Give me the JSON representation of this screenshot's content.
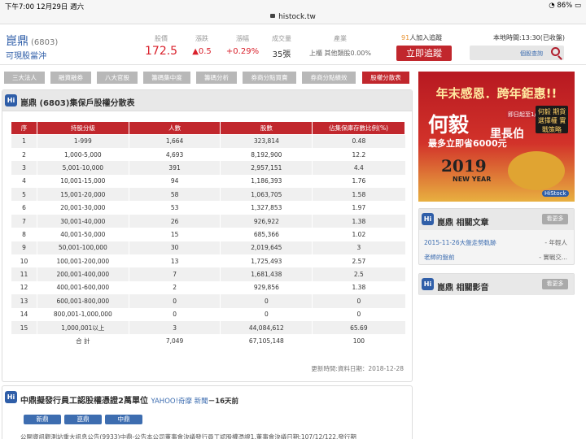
{
  "status_bar": {
    "time": "下午7:00",
    "date": "12月29日 週六",
    "battery": "86%"
  },
  "url": "histock.tw",
  "stock": {
    "name": "崑鼎",
    "code": "(6803)",
    "subtitle": "可現股當沖"
  },
  "stats": [
    {
      "label": "股價",
      "value": "172.5"
    },
    {
      "label": "漲跌",
      "value": "▲0.5"
    },
    {
      "label": "漲幅",
      "value": "+0.29%"
    },
    {
      "label": "成交量",
      "value": "35張"
    },
    {
      "label": "產業",
      "value": "上櫃 其他類股0.00%"
    }
  ],
  "follow": {
    "count": "91",
    "text": "人加入追蹤"
  },
  "track_button": "立即追蹤",
  "local_time": "本地時間:13:30(已收盤)",
  "search_placeholder": "個股查詢",
  "tabs": [
    "三大法人",
    "融資融券",
    "八大官股",
    "籌碼集中度",
    "籌碼分析",
    "券商分點買賣",
    "券商分點績效",
    "股權分散表"
  ],
  "panel_title": "崑鼎 (6803)集保戶股權分散表",
  "table": {
    "headers": [
      "序",
      "持股分級",
      "人數",
      "股數",
      "佔集保庫存數比例(%)"
    ],
    "rows": [
      [
        "1",
        "1-999",
        "1,664",
        "323,814",
        "0.48"
      ],
      [
        "2",
        "1,000-5,000",
        "4,693",
        "8,192,900",
        "12.2"
      ],
      [
        "3",
        "5,001-10,000",
        "391",
        "2,957,151",
        "4.4"
      ],
      [
        "4",
        "10,001-15,000",
        "94",
        "1,186,393",
        "1.76"
      ],
      [
        "5",
        "15,001-20,000",
        "58",
        "1,063,705",
        "1.58"
      ],
      [
        "6",
        "20,001-30,000",
        "53",
        "1,327,853",
        "1.97"
      ],
      [
        "7",
        "30,001-40,000",
        "26",
        "926,922",
        "1.38"
      ],
      [
        "8",
        "40,001-50,000",
        "15",
        "685,366",
        "1.02"
      ],
      [
        "9",
        "50,001-100,000",
        "30",
        "2,019,645",
        "3"
      ],
      [
        "10",
        "100,001-200,000",
        "13",
        "1,725,493",
        "2.57"
      ],
      [
        "11",
        "200,001-400,000",
        "7",
        "1,681,438",
        "2.5"
      ],
      [
        "12",
        "400,001-600,000",
        "2",
        "929,856",
        "1.38"
      ],
      [
        "13",
        "600,001-800,000",
        "0",
        "0",
        "0"
      ],
      [
        "14",
        "800,001-1,000,000",
        "0",
        "0",
        "0"
      ],
      [
        "15",
        "1,000,001以上",
        "3",
        "44,084,612",
        "65.69"
      ],
      [
        "",
        "合 計",
        "7,049",
        "67,105,148",
        "100"
      ]
    ]
  },
  "updated": "更新時間:資料日期：2018-12-28",
  "news": {
    "title": "中鼎擬發行員工認股權憑證2萬單位",
    "source": "YAHOO!奇摩 新聞",
    "age": "－16天前",
    "tags": [
      "新鼎",
      "崑鼎",
      "中鼎"
    ],
    "snippet": "公開資訊觀測站重大訊息公告(9933)中鼎-公告本公司董事會決議發行員工認股權憑證1.董事會決議日期:107/12/122.發行期"
  },
  "ad": {
    "line1": "年末感恩．跨年鉅惠!!",
    "name": "何毅",
    "title_word": "里長伯",
    "tag": "即日起至1/6",
    "promo": "最多立即省6000元",
    "box": "何毅 期貨選擇權 實戰策略",
    "year": "2019",
    "year_sub": "NEW YEAR",
    "logo": "HiStock"
  },
  "sidebar": {
    "articles_title": "崑鼎 相關文章",
    "more": "看更多",
    "articles": [
      {
        "title": "2015-11-26大盤走勢軌跡",
        "author": "- 年輕人"
      },
      {
        "title": "老師的盤前",
        "author": "- 實戰交..."
      }
    ],
    "videos_title": "崑鼎 相關影音"
  },
  "icon_badge": "Hi"
}
